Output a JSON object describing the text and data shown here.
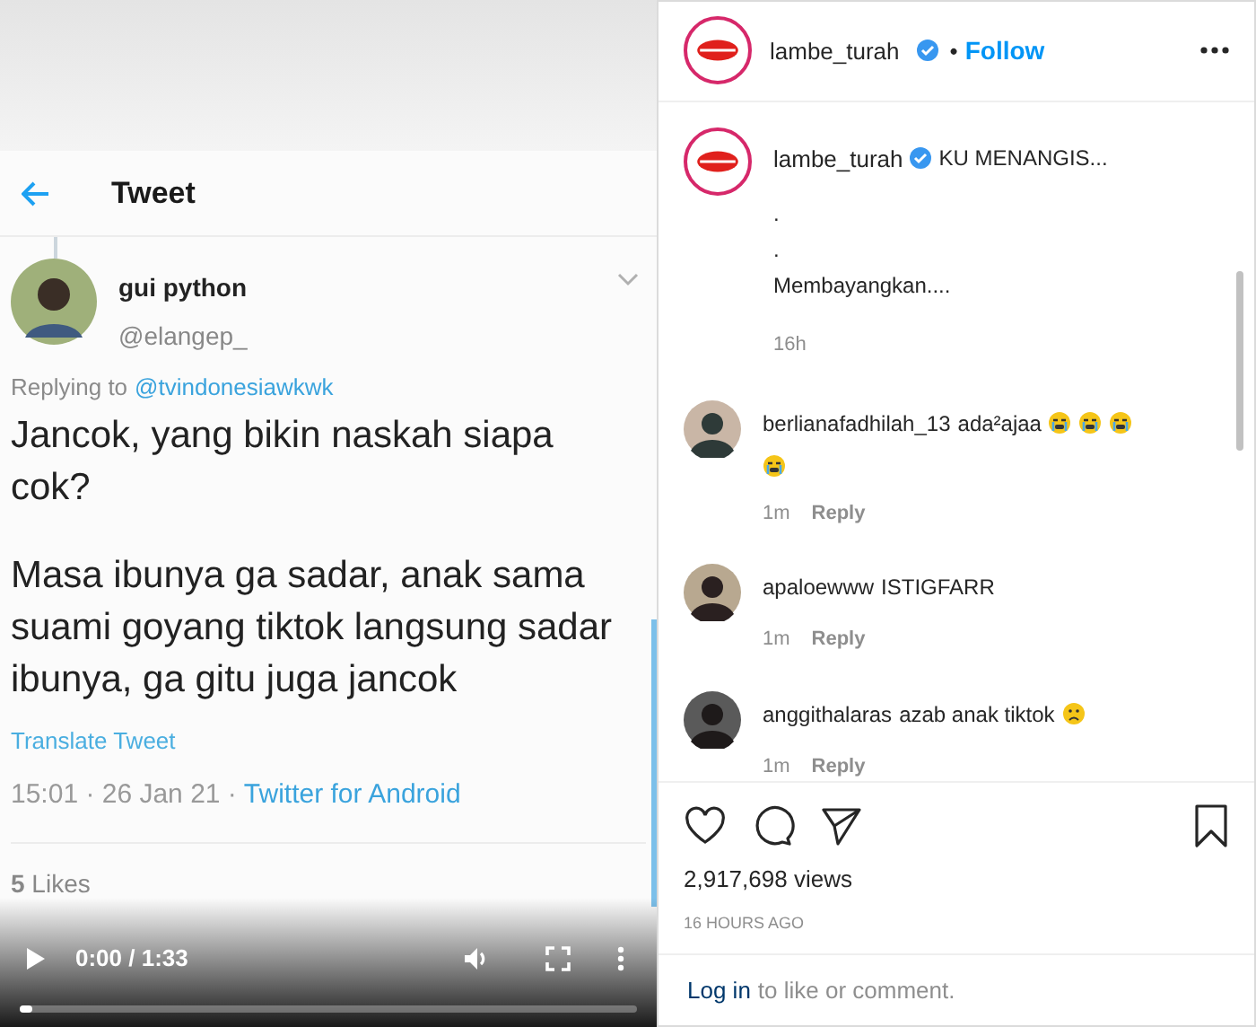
{
  "video": {
    "tweet": {
      "header_title": "Tweet",
      "author_name": "gui python",
      "author_handle": "@elangep_",
      "replying_label": "Replying to",
      "replying_to": "@tvindonesiawkwk",
      "paragraphs": [
        "Jancok, yang bikin naskah siapa cok?",
        "Masa ibunya ga sadar, anak sama suami goyang tiktok langsung sadar ibunya, ga gitu juga jancok"
      ],
      "translate": "Translate Tweet",
      "time": "15:01 · 26 Jan 21 ·",
      "source": "Twitter for Android",
      "likes": "**5** Likes"
    },
    "controls": {
      "time": "0:00 / 1:33",
      "level": 0.02
    }
  },
  "post": {
    "username": "lambe_turah",
    "verified": true,
    "separator": "•",
    "follow": "Follow",
    "caption": {
      "username": "lambe_turah",
      "lines": [
        "KU MENANGIS...",
        ".",
        ".",
        "Membayangkan...."
      ],
      "age": "16h"
    },
    "comments": [
      {
        "username": "berlianafadhilah_13",
        "text": "ada²ajaa",
        "emojis": [
          {
            "kind": "crying"
          },
          {
            "kind": "crying"
          },
          {
            "kind": "crying"
          },
          {
            "kind": "crying"
          }
        ],
        "time": "1m",
        "reply": "Reply"
      },
      {
        "username": "apaloewww",
        "text": "ISTIGFARR",
        "time": "1m",
        "reply": "Reply"
      },
      {
        "username": "anggithalaras",
        "text": "azab anak tiktok",
        "emojis": [
          {
            "kind": "frowning"
          }
        ],
        "time": "1m",
        "reply": "Reply"
      }
    ],
    "views": "2,917,698 views",
    "posted": "16 HOURS AGO",
    "login_link": "Log in",
    "login_rest": "to like or comment."
  }
}
